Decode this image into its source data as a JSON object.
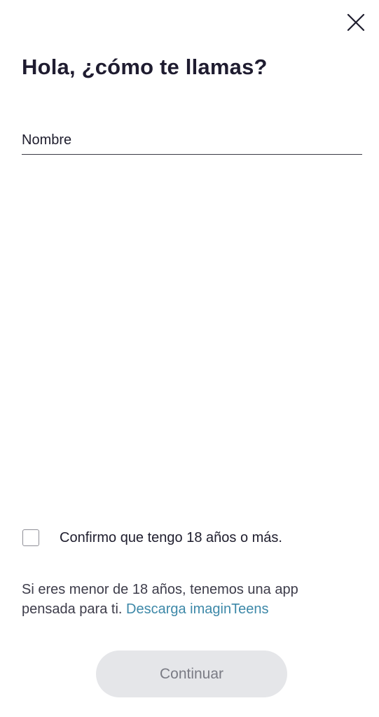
{
  "header": {
    "close_icon": "close-icon",
    "title": "Hola, ¿cómo te llamas?"
  },
  "name_field": {
    "placeholder": "Nombre",
    "value": ""
  },
  "age_confirmation": {
    "checked": false,
    "label": "Confirmo que tengo 18 años o más."
  },
  "teens_notice": {
    "text": "Si eres menor de 18 años, tenemos una app pensada para ti. ",
    "link_label": "Descarga imaginTeens",
    "link_color": "#3d88a8"
  },
  "footer": {
    "continue_label": "Continuar",
    "continue_enabled": false
  },
  "colors": {
    "text": "#1e1d2d",
    "button_disabled_bg": "#e5e6e9",
    "button_disabled_text": "#7a7b84"
  }
}
